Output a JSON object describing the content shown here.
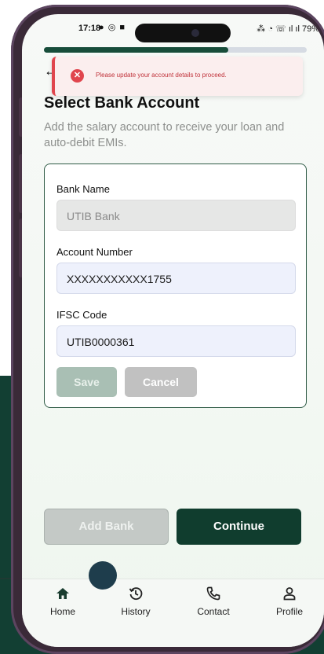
{
  "status_bar": {
    "time": "17:18",
    "left_icons": "● ◎ ■",
    "right_text": "⁂ ◔ ☏ ıl ıl 79%"
  },
  "progress": {
    "value": 0.7
  },
  "toast": {
    "message": "Please update your account details to proceed.",
    "icon": "x-icon",
    "color": "#e0454d"
  },
  "page": {
    "title": "Select Bank Account",
    "subtitle": "Add the salary account to receive your loan and auto-debit EMIs."
  },
  "form": {
    "bank_name_label": "Bank Name",
    "bank_name_value": "UTIB Bank",
    "account_number_label": "Account Number",
    "account_number_value": "XXXXXXXXXXX1755",
    "ifsc_label": "IFSC Code",
    "ifsc_value": "UTIB0000361",
    "save_label": "Save",
    "cancel_label": "Cancel"
  },
  "actions": {
    "add_bank_label": "Add Bank",
    "continue_label": "Continue"
  },
  "nav": {
    "items": [
      {
        "label": "Home",
        "icon": "home-icon"
      },
      {
        "label": "History",
        "icon": "history-icon"
      },
      {
        "label": "Contact",
        "icon": "phone-icon"
      },
      {
        "label": "Profile",
        "icon": "profile-icon"
      }
    ]
  },
  "colors": {
    "brand_dark_green": "#103d2e",
    "error_red": "#e0454d",
    "input_bg": "#eef1fc"
  }
}
